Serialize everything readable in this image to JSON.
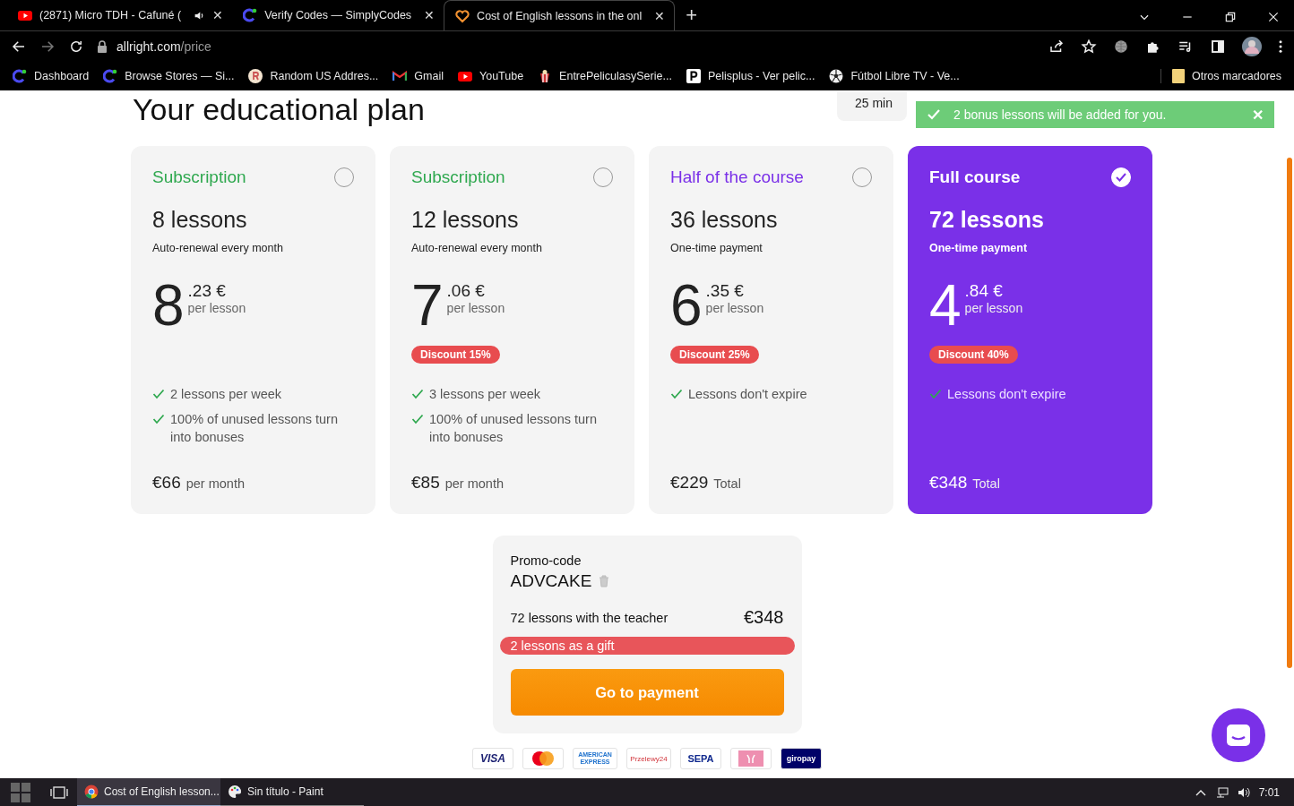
{
  "browser": {
    "tabs": [
      {
        "title": "(2871) Micro TDH - Cafuné (",
        "kind": "youtube",
        "audio": true,
        "close": "✕",
        "selected": false
      },
      {
        "title": "Verify Codes — SimplyCodes",
        "kind": "simplycodes",
        "audio": false,
        "close": "✕",
        "selected": false
      },
      {
        "title": "Cost of English lessons in the onl",
        "kind": "heart",
        "audio": false,
        "close": "✕",
        "selected": true
      }
    ],
    "new_tab": "+",
    "url_host": "allright.com",
    "url_path": "/price",
    "bookmarks": [
      {
        "label": "Dashboard",
        "kind": "simplycodes"
      },
      {
        "label": "Browse Stores — Si...",
        "kind": "simplycodes"
      },
      {
        "label": "Random US Addres...",
        "kind": "r"
      },
      {
        "label": "Gmail",
        "kind": "gmail"
      },
      {
        "label": "YouTube",
        "kind": "youtube"
      },
      {
        "label": "EntrePeliculasySerie...",
        "kind": "popcorn"
      },
      {
        "label": "Pelisplus - Ver pelic...",
        "kind": "p"
      },
      {
        "label": "Fútbol Libre TV - Ve...",
        "kind": "ball"
      }
    ],
    "other_bookmarks": "Otros marcadores"
  },
  "page": {
    "title": "Your educational plan",
    "duration": "25 min",
    "toast": {
      "text": "2 bonus lessons will be added for you.",
      "close": "✕"
    },
    "plans": [
      {
        "title": "Subscription",
        "lessons": "8 lessons",
        "payment": "Auto-renewal every month",
        "price_int": "8",
        "price_dec": ".23 €",
        "price_unit": "per lesson",
        "features": [
          "2 lessons per week",
          "100% of unused lessons turn into bonuses"
        ],
        "total": "€66",
        "total_label": "per month",
        "selected": false
      },
      {
        "title": "Subscription",
        "lessons": "12 lessons",
        "payment": "Auto-renewal every month",
        "price_int": "7",
        "price_dec": ".06 €",
        "price_unit": "per lesson",
        "discount": "Discount 15%",
        "features": [
          "3 lessons per week",
          "100% of unused lessons turn into bonuses"
        ],
        "total": "€85",
        "total_label": "per month",
        "selected": false
      },
      {
        "title": "Half of the course",
        "lessons": "36 lessons",
        "payment": "One-time payment",
        "price_int": "6",
        "price_dec": ".35 €",
        "price_unit": "per lesson",
        "discount": "Discount 25%",
        "features": [
          "Lessons don't expire"
        ],
        "total": "€229",
        "total_label": "Total",
        "selected": false
      },
      {
        "title": "Full course",
        "lessons": "72 lessons",
        "payment": "One-time payment",
        "price_int": "4",
        "price_dec": ".84 €",
        "price_unit": "per lesson",
        "discount": "Discount 40%",
        "features": [
          "Lessons don't expire"
        ],
        "total": "€348",
        "total_label": "Total",
        "selected": true
      }
    ],
    "summary": {
      "promo_label": "Promo-code",
      "promo_code": "ADVCAKE",
      "item": "72 lessons with the teacher",
      "amount": "€348",
      "gift": "2 lessons as a gift",
      "pay_button": "Go to payment"
    },
    "payment_methods": [
      {
        "kind": "visa",
        "label": "VISA"
      },
      {
        "kind": "mastercard"
      },
      {
        "kind": "amex",
        "label": "AMERICAN EXPRESS"
      },
      {
        "kind": "przelewy",
        "label": "Przelewy24"
      },
      {
        "kind": "sepa",
        "label": "SEPA"
      },
      {
        "kind": "sofort"
      },
      {
        "kind": "giropay",
        "label": "giropay"
      }
    ]
  },
  "taskbar": {
    "apps": [
      {
        "label": "Cost of English lesson...",
        "kind": "chrome",
        "selected": true
      },
      {
        "label": "Sin título - Paint",
        "kind": "paint",
        "selected": false
      }
    ],
    "time": "7:01"
  }
}
